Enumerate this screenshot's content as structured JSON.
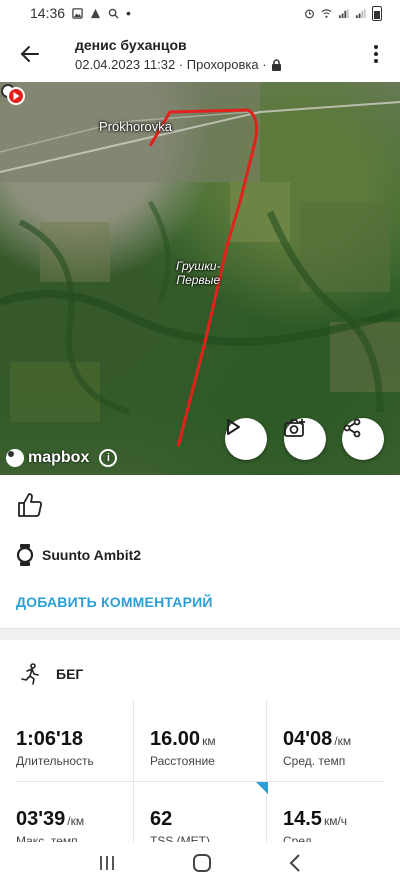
{
  "status_bar": {
    "time": "14:36",
    "dot": "•"
  },
  "header": {
    "title": "денис буханцов",
    "datetime_location": "02.04.2023 11:32 · Прохоровка ·"
  },
  "map": {
    "town_label": "Prokhorovka",
    "village_label_line1": "Грушки-",
    "village_label_line2": "Первые",
    "attribution": "mapbox",
    "route_color": "#e3211c"
  },
  "device": {
    "name": "Suunto Ambit2"
  },
  "comment": {
    "add_label": "ДОБАВИТЬ КОММЕНТАРИЙ"
  },
  "activity": {
    "type": "БЕГ"
  },
  "stats": [
    {
      "value": "1:06'18",
      "unit": "",
      "label": "Длительность"
    },
    {
      "value": "16.00",
      "unit": "км",
      "label": "Расстояние"
    },
    {
      "value": "04'08",
      "unit": "/км",
      "label": "Сред. темп"
    },
    {
      "value": "03'39",
      "unit": "/км",
      "label": "Макс. темп"
    },
    {
      "value": "62",
      "unit": "",
      "label": "TSS (MET)"
    },
    {
      "value": "14.5",
      "unit": "км/ч",
      "label": "Сред."
    }
  ],
  "colors": {
    "accent": "#2b9fd6"
  }
}
